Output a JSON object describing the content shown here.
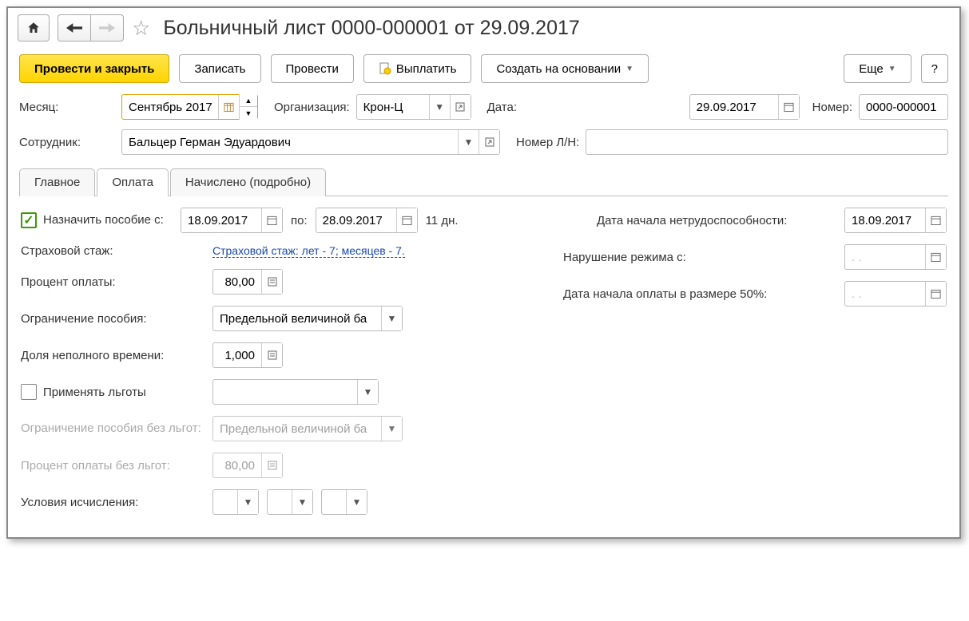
{
  "title": "Больничный лист 0000-000001 от 29.09.2017",
  "toolbar": {
    "post_close": "Провести и закрыть",
    "write": "Записать",
    "post": "Провести",
    "pay": "Выплатить",
    "create_based": "Создать на основании",
    "more": "Еще",
    "help": "?"
  },
  "header": {
    "month_label": "Месяц:",
    "month_value": "Сентябрь 2017",
    "org_label": "Организация:",
    "org_value": "Крон-Ц",
    "date_label": "Дата:",
    "date_value": "29.09.2017",
    "number_label": "Номер:",
    "number_value": "0000-000001",
    "employee_label": "Сотрудник:",
    "employee_value": "Бальцер Герман Эдуардович",
    "ln_number_label": "Номер Л/Н:",
    "ln_number_value": ""
  },
  "tabs": {
    "main": "Главное",
    "payment": "Оплата",
    "detailed": "Начислено (подробно)"
  },
  "payment": {
    "assign_label": "Назначить пособие с:",
    "date_from": "18.09.2017",
    "to_label": "по:",
    "date_to": "28.09.2017",
    "days": "11 дн.",
    "start_disability_label": "Дата начала нетрудоспособности:",
    "start_disability_value": "18.09.2017",
    "insurance_label": "Страховой стаж:",
    "insurance_link": "Страховой стаж: лет - 7;  месяцев - 7.",
    "violation_label": "Нарушение режима с:",
    "violation_value": ". .",
    "percent_label": "Процент оплаты:",
    "percent_value": "80,00",
    "half_pay_label": "Дата начала оплаты в размере 50%:",
    "half_pay_value": ". .",
    "limit_label": "Ограничение пособия:",
    "limit_value": "Предельной величиной ба",
    "part_time_label": "Доля неполного времени:",
    "part_time_value": "1,000",
    "apply_benefits_label": "Применять льготы",
    "limit_no_benefits_label": "Ограничение пособия без льгот:",
    "limit_no_benefits_value": "Предельной величиной ба",
    "percent_no_benefits_label": "Процент оплаты без льгот:",
    "percent_no_benefits_value": "80,00",
    "conditions_label": "Условия исчисления:"
  }
}
